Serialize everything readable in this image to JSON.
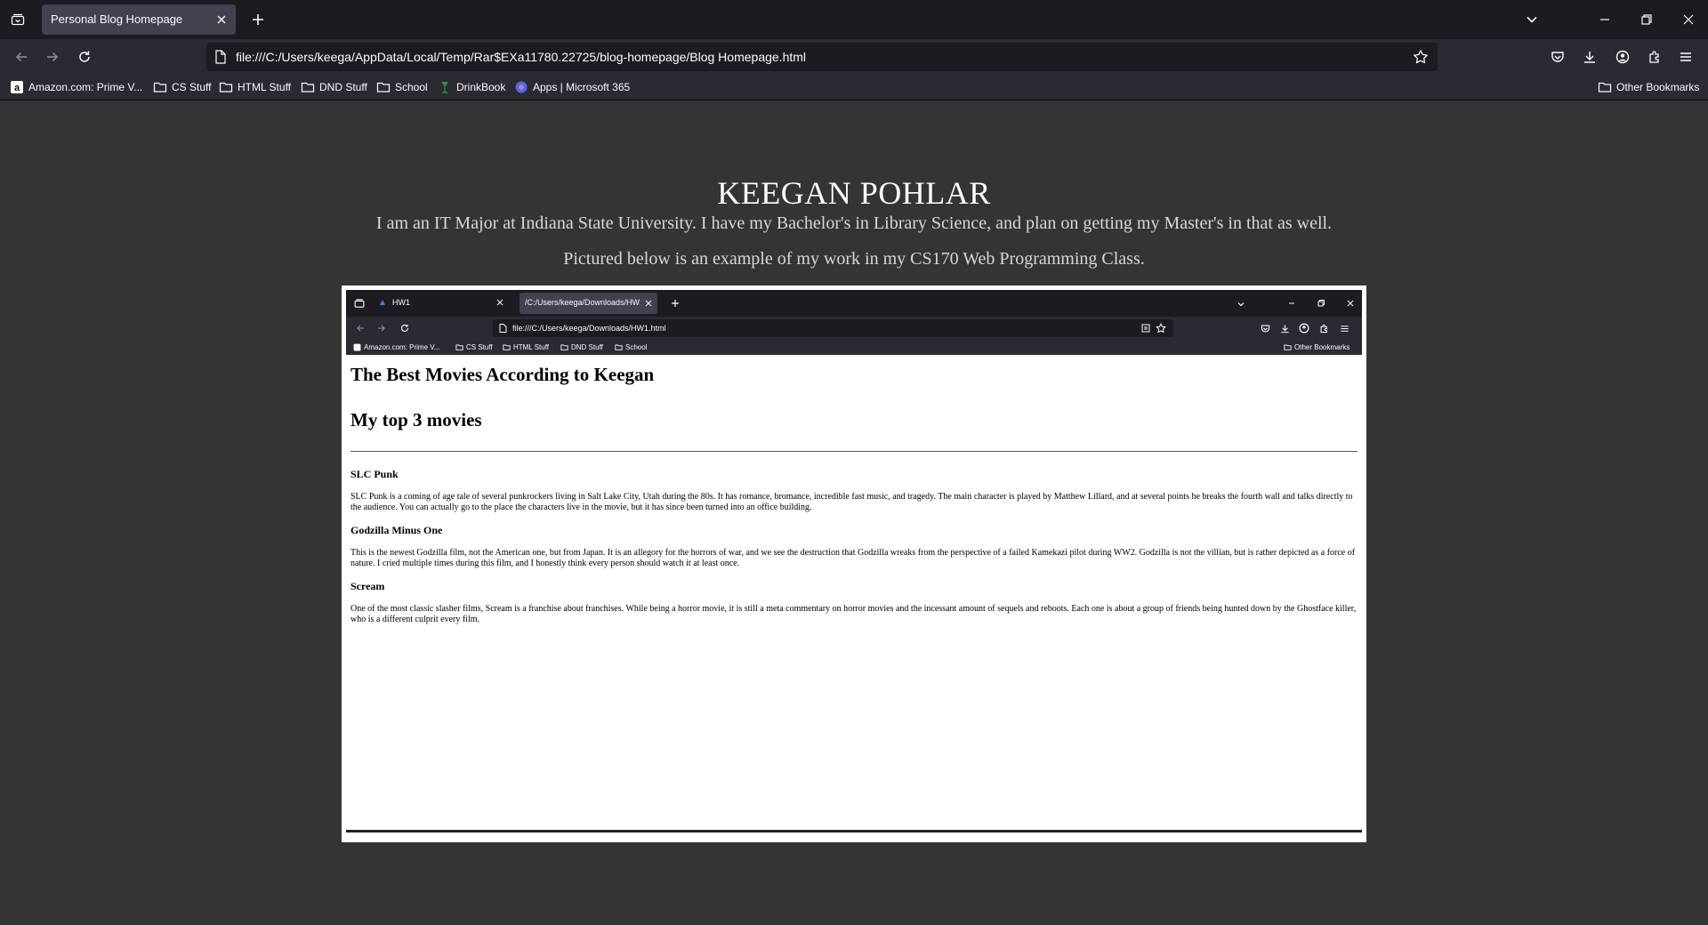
{
  "browser": {
    "tab_title": "Personal Blog Homepage",
    "url": "file:///C:/Users/keega/AppData/Local/Temp/Rar$EXa11780.22725/blog-homepage/Blog Homepage.html",
    "bookmarks": [
      {
        "label": "Amazon.com: Prime V...",
        "icon": "amazon-icon"
      },
      {
        "label": "CS Stuff",
        "icon": "folder-icon"
      },
      {
        "label": "HTML Stuff",
        "icon": "folder-icon"
      },
      {
        "label": "DND Stuff",
        "icon": "folder-icon"
      },
      {
        "label": "School",
        "icon": "folder-icon"
      },
      {
        "label": "DrinkBook",
        "icon": "drinkbook-icon"
      },
      {
        "label": "Apps | Microsoft 365",
        "icon": "microsoft-365-icon"
      }
    ],
    "other_bookmarks": "Other Bookmarks"
  },
  "page": {
    "title": "KEEGAN POHLAR",
    "intro": "I am an IT Major at Indiana State University. I have my Bachelor's in Library Science, and plan on getting my Master's in that as well.",
    "pictured": "Pictured below is an example of my work in my CS170 Web Programming Class."
  },
  "screenshot": {
    "tabs": [
      {
        "title": "HW1"
      },
      {
        "title": "/C:/Users/keega/Downloads/HW1.h"
      }
    ],
    "url": "file:///C:/Users/keega/Downloads/HW1.html",
    "bookmarks": [
      {
        "label": "Amazon.com: Prime V..."
      },
      {
        "label": "CS Stuff"
      },
      {
        "label": "HTML Stuff"
      },
      {
        "label": "DND Stuff"
      },
      {
        "label": "School"
      }
    ],
    "other_bookmarks": "Other Bookmarks",
    "heading": "The Best Movies According to Keegan",
    "subheading": "My top 3 movies",
    "movies": [
      {
        "title": "SLC Punk",
        "description": "SLC Punk is a coming of age tale of several punkrockers living in Salt Lake City, Utah during the 80s. It has romance, bromance, incredible fast music, and tragedy. The main character is played by Matthew Lillard, and at several points he breaks the fourth wall and talks directly to the audience. You can actually go to the place the characters live in the movie, but it has since been turned into an office building."
      },
      {
        "title": "Godzilla Minus One",
        "description": "This is the newest Godzilla film, not the American one, but from Japan. It is an allegory for the horrors of war, and we see the destruction that Godzilla wreaks from the perspective of a failed Kamekazi pilot during WW2. Godzilla is not the villian, but is rather depicted as a force of nature. I cried multiple times during this film, and I honestly think every person should watch it at least once."
      },
      {
        "title": "Scream",
        "description": "One of the most classic slasher films, Scream is a franchise about franchises. While being a horror movie, it is still a meta commentary on horror movies and the incessant amount of sequels and reboots. Each one is about a group of friends being hunted down by the Ghostface killer, who is a different culprit every film."
      }
    ]
  }
}
